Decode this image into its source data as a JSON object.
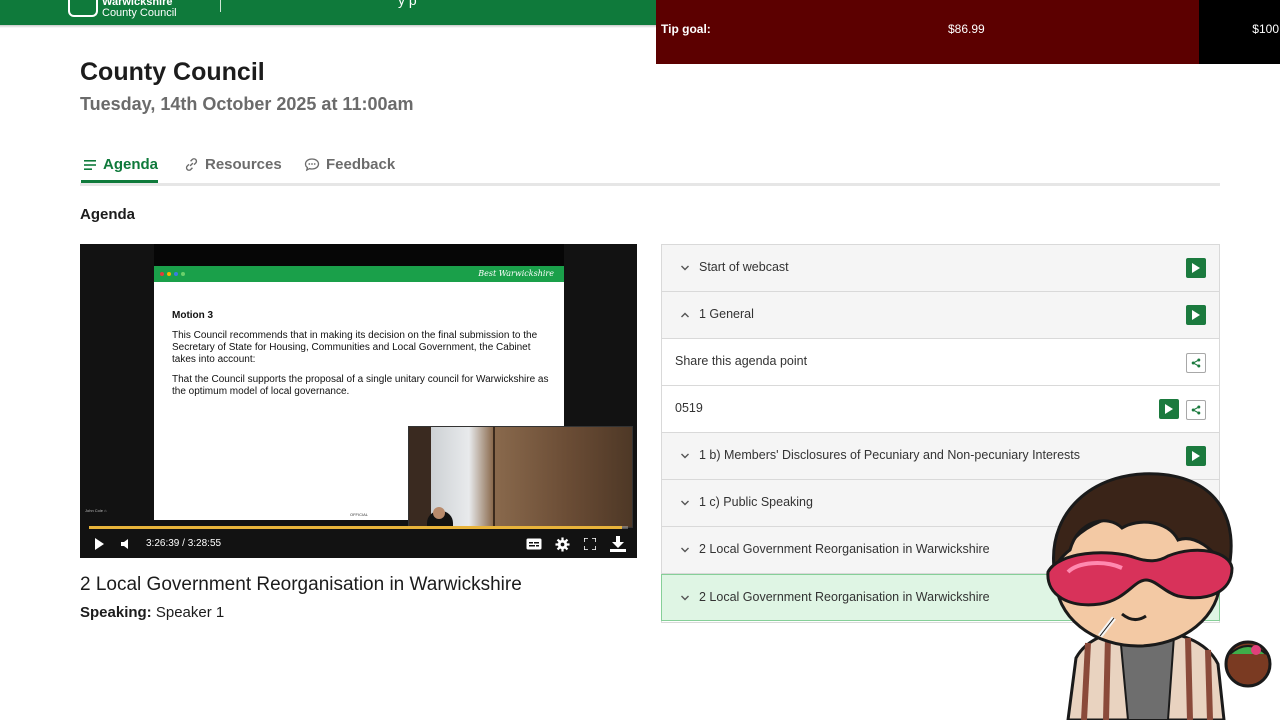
{
  "header": {
    "logo_line1": "Warwickshire",
    "logo_line2": "County Council",
    "nav_fragment": "y   p"
  },
  "tip_goal": {
    "label": "Tip goal:",
    "current": "$86.99",
    "goal": "$100",
    "progress_fraction": 0.8699,
    "bar_color": "#5c0000"
  },
  "meeting": {
    "title": "County Council",
    "date": "Tuesday, 14th October 2025 at 11:00am"
  },
  "tabs": [
    {
      "label": "Agenda",
      "icon": "list-icon",
      "active": true
    },
    {
      "label": "Resources",
      "icon": "link-icon",
      "active": false
    },
    {
      "label": "Feedback",
      "icon": "speech-bubble-icon",
      "active": false
    }
  ],
  "section_heading": "Agenda",
  "video": {
    "slide_brand": "Best Warwickshire",
    "slide_heading": "Motion 3",
    "slide_para1": "This Council recommends that in making its decision on the final submission to the Secretary of State for Housing, Communities and Local Government, the Cabinet takes into account:",
    "slide_para2": "That the Council supports the proposal of a single unitary council for Warwickshire as the optimum model of local governance.",
    "slide_footer": "OFFICIAL",
    "caption_tag": "John Cole  ⌂",
    "time_current": "3:26:39",
    "time_separator": "/",
    "time_total": "3:28:55",
    "progress_fraction": 0.989,
    "progress_color": "#e8b33a"
  },
  "now_playing": {
    "title": "2 Local Government Reorganisation in Warwickshire",
    "speaking_label": "Speaking:",
    "speaker": "Speaker 1"
  },
  "agenda_items": [
    {
      "label": "Start of webcast",
      "chevron": "down",
      "play": true,
      "share": false
    },
    {
      "label": "1 General",
      "chevron": "up",
      "play": true,
      "share": false
    },
    {
      "label": "Share this agenda point",
      "chevron": "none",
      "play": false,
      "share": true
    },
    {
      "label": "0519",
      "chevron": "none",
      "play": true,
      "share": true
    },
    {
      "label": "1 b) Members' Disclosures of Pecuniary and Non-pecuniary Interests",
      "chevron": "down",
      "play": true,
      "share": false
    },
    {
      "label": "1 c) Public Speaking",
      "chevron": "down",
      "play": false,
      "share": false
    },
    {
      "label": "2 Local Government Reorganisation in Warwickshire",
      "chevron": "down",
      "play": false,
      "share": false
    },
    {
      "label": "2 Local Government Reorganisation in Warwickshire",
      "chevron": "down",
      "play": false,
      "share": false,
      "active": true
    }
  ],
  "colors": {
    "brand_green": "#0f7a3b",
    "play_button": "#1b7a3e",
    "active_row": "#dff5e4"
  },
  "overlay": {
    "mascot_icon": "cartoon-streamer-avatar-icon"
  }
}
